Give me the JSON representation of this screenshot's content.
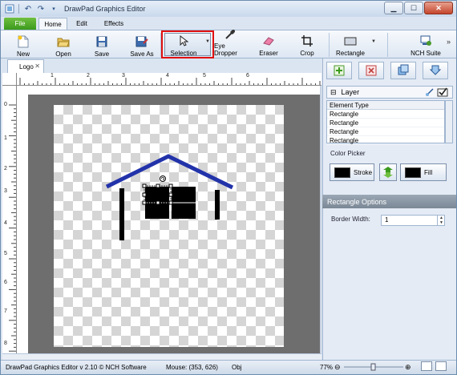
{
  "window": {
    "title": "DrawPad Graphics Editor"
  },
  "menu_tabs": {
    "file": "File",
    "home": "Home",
    "edit": "Edit",
    "effects": "Effects"
  },
  "toolbar": {
    "new": "New",
    "open": "Open",
    "save": "Save",
    "save_as": "Save As",
    "selection": "Selection",
    "eye_dropper": "Eye Dropper",
    "eraser": "Eraser",
    "crop": "Crop",
    "rectangle": "Rectangle",
    "nch_suite": "NCH Suite"
  },
  "document": {
    "tab_label": "Logo"
  },
  "ruler": {
    "h_labels": [
      "1",
      "2",
      "3",
      "4",
      "5",
      "6"
    ],
    "v_labels": [
      "0",
      "1",
      "2",
      "3",
      "4",
      "5",
      "6",
      "7",
      "8"
    ]
  },
  "layer_panel": {
    "title": "Layer",
    "header": "Element Type",
    "rows": [
      "Rectangle",
      "Rectangle",
      "Rectangle",
      "Rectangle"
    ]
  },
  "color_picker": {
    "title": "Color Picker",
    "stroke_label": "Stroke",
    "fill_label": "Fill",
    "stroke_color": "#000000",
    "fill_color": "#000000"
  },
  "rectangle_options": {
    "title": "Rectangle Options",
    "border_width_label": "Border Width:",
    "border_width_value": "1"
  },
  "status": {
    "app_info": "DrawPad Graphics Editor v 2.10 © NCH Software",
    "mouse": "Mouse: (353, 626)",
    "obj": "Obj",
    "zoom": "77%"
  },
  "colors": {
    "roof": "#2233aa",
    "accent_file": "#3c9a1d",
    "highlight": "#e01010"
  }
}
